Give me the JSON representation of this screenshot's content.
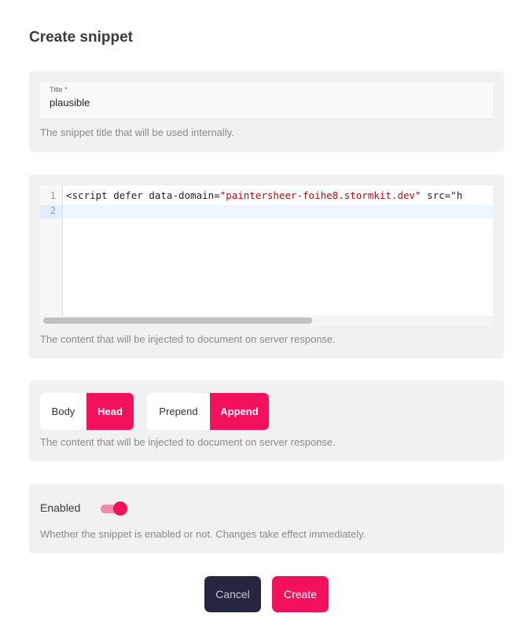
{
  "page": {
    "title": "Create snippet"
  },
  "title_field": {
    "label": "Title *",
    "value": "plausible",
    "help": "The snippet title that will be used internally."
  },
  "content_field": {
    "line_numbers": [
      "1",
      "2"
    ],
    "code_prefix": "<script defer data-domain=",
    "code_string": "\"paintersheer-foihe8.stormkit.dev\"",
    "code_suffix": " src=\"h",
    "help": "The content that will be injected to document on server response."
  },
  "location": {
    "target_options": [
      "Body",
      "Head"
    ],
    "target_selected": "Head",
    "position_options": [
      "Prepend",
      "Append"
    ],
    "position_selected": "Append",
    "help": "The content that will be injected to document on server response."
  },
  "enabled": {
    "label": "Enabled",
    "value": true,
    "help": "Whether the snippet is enabled or not. Changes take effect immediately."
  },
  "actions": {
    "cancel": "Cancel",
    "create": "Create"
  },
  "colors": {
    "accent": "#f3105c",
    "cancel_bg": "#262641",
    "card_bg": "#f1f1f1"
  }
}
